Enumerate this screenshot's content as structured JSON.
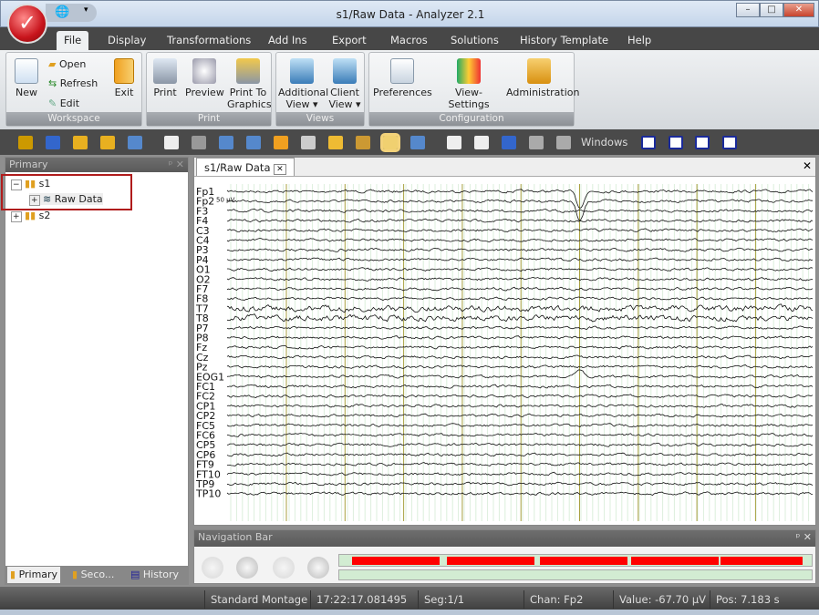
{
  "window": {
    "title": "s1/Raw Data - Analyzer 2.1"
  },
  "ribbon_tabs": [
    "File",
    "Display",
    "Transformations",
    "Add Ins",
    "Export",
    "Macros",
    "Solutions",
    "History Template",
    "Help"
  ],
  "ribbon": {
    "workspace": {
      "label": "Workspace",
      "new": "New",
      "open": "Open",
      "refresh": "Refresh",
      "edit": "Edit",
      "exit": "Exit"
    },
    "print": {
      "label": "Print",
      "print": "Print",
      "preview": "Preview",
      "print_to": "Print To",
      "graphics": "Graphics"
    },
    "views": {
      "label": "Views",
      "additional": "Additional",
      "client": "Client",
      "view": "View ▾"
    },
    "configuration": {
      "label": "Configuration",
      "preferences": "Preferences",
      "view_settings": "View-Settings",
      "administration": "Administration"
    }
  },
  "toolbar": {
    "windows_label": "Windows"
  },
  "left_panel": {
    "title": "Primary",
    "tree": [
      {
        "label": "s1",
        "children": [
          "Raw Data"
        ]
      },
      {
        "label": "s2"
      }
    ],
    "tabs": [
      "Primary",
      "Seco...",
      "History"
    ]
  },
  "document": {
    "tab": "s1/Raw Data",
    "scale_label": "50 µV",
    "channels": [
      "Fp1",
      "Fp2",
      "F3",
      "F4",
      "C3",
      "C4",
      "P3",
      "P4",
      "O1",
      "O2",
      "F7",
      "F8",
      "T7",
      "T8",
      "P7",
      "P8",
      "Fz",
      "Cz",
      "Pz",
      "EOG1",
      "FC1",
      "FC2",
      "CP1",
      "CP2",
      "FC5",
      "FC6",
      "CP5",
      "CP6",
      "FT9",
      "FT10",
      "TP9",
      "TP10"
    ]
  },
  "navigation_bar": {
    "title": "Navigation Bar"
  },
  "status": {
    "montage": "Standard Montage",
    "time": "17:22:17.081495",
    "segment": "Seg:1/1",
    "channel": "Chan:  Fp2",
    "value": "Value: -67.70 µV",
    "position": "Pos:  7.183 s"
  },
  "colors": {
    "highlight_box": "#b01c1c",
    "nav_segments": "#ff0000",
    "marker_lines": "#a8a040"
  }
}
